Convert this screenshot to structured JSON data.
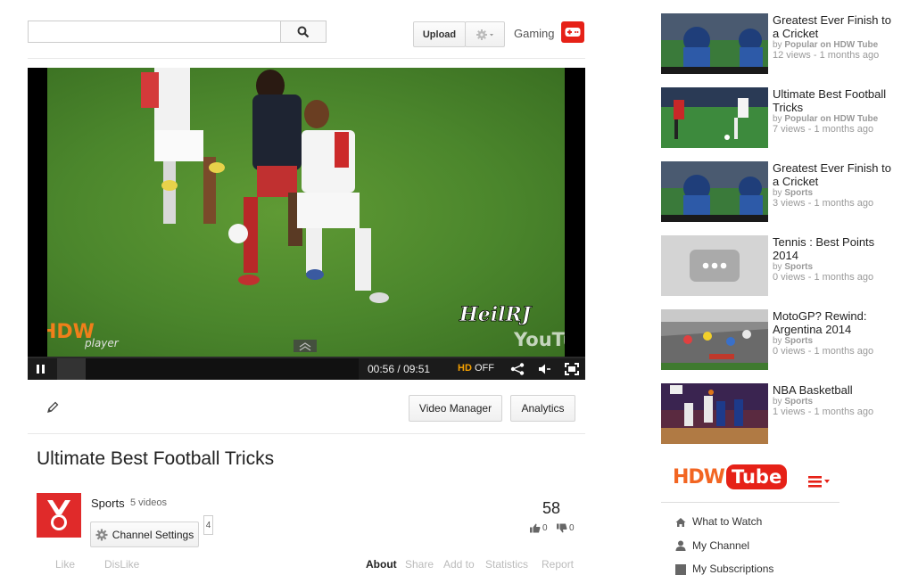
{
  "header": {
    "search_placeholder": "",
    "upload_label": "Upload",
    "gaming_label": "Gaming"
  },
  "player": {
    "time_current": "00:56",
    "time_total": "09:51",
    "time_sep": "/",
    "hd_label": "HD",
    "hd_state": "OFF",
    "watermark_hdw": "HDW",
    "watermark_player": "player",
    "watermark_user": "HeilRJ",
    "watermark_youtube": "YouTube",
    "progress_fraction": 0.095
  },
  "actions": {
    "video_manager_label": "Video Manager",
    "analytics_label": "Analytics"
  },
  "video": {
    "title": "Ultimate Best Football Tricks",
    "channel_name": "Sports",
    "videos_count": "5 videos",
    "channel_settings_label": "Channel Settings",
    "subscriber_count": "4",
    "view_count": "58",
    "likes": "0",
    "dislikes": "0"
  },
  "tabs": {
    "like": "Like",
    "dislike": "DisLike",
    "about": "About",
    "share": "Share",
    "add_to": "Add to",
    "statistics": "Statistics",
    "report": "Report"
  },
  "sidebar": {
    "items": [
      {
        "title": "Greatest Ever Finish to a Cricket",
        "by_prefix": "by",
        "by": "Popular on HDW Tube",
        "views": "12 views - 1 months ago",
        "thumb": "cricket"
      },
      {
        "title": "Ultimate Best Football Tricks",
        "by_prefix": "by",
        "by": "Popular on HDW Tube",
        "views": "7 views - 1 months ago",
        "thumb": "football"
      },
      {
        "title": "Greatest Ever Finish to a Cricket",
        "by_prefix": "by",
        "by": "Sports",
        "views": "3 views - 1 months ago",
        "thumb": "cricket"
      },
      {
        "title": "Tennis : Best Points 2014",
        "by_prefix": "by",
        "by": "Sports",
        "views": "0 views - 1 months ago",
        "thumb": "placeholder"
      },
      {
        "title": "MotoGP? Rewind: Argentina 2014",
        "by_prefix": "by",
        "by": "Sports",
        "views": "0 views - 1 months ago",
        "thumb": "motogp"
      },
      {
        "title": "NBA Basketball",
        "by_prefix": "by",
        "by": "Sports",
        "views": "1 views - 1 months ago",
        "thumb": "nba"
      }
    ],
    "logo_hdw": "HDW",
    "logo_tube": "Tube",
    "menu": [
      "What to Watch",
      "My Channel",
      "My Subscriptions"
    ]
  },
  "colors": {
    "brand_red": "#e62117",
    "logo_orange": "#f26522",
    "hd_orange": "#f4a000"
  }
}
